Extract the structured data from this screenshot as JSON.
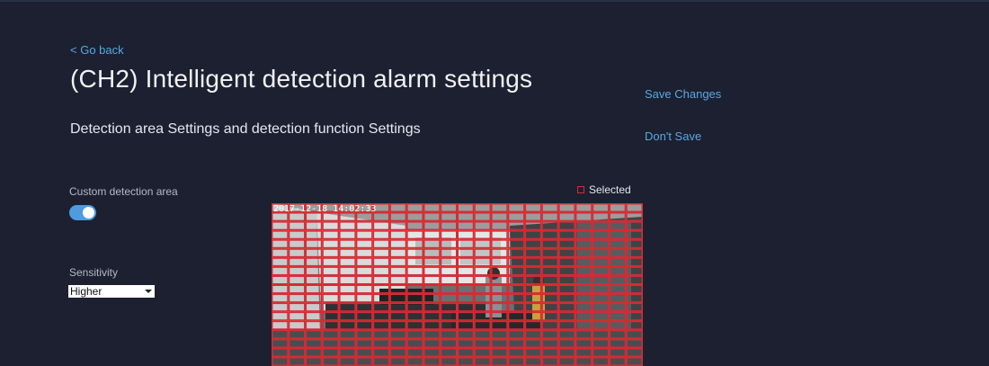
{
  "nav": {
    "back_label": "< Go back"
  },
  "header": {
    "title": "(CH2)  Intelligent detection alarm settings",
    "section_title": "Detection area Settings and detection function Settings"
  },
  "actions": {
    "save": "Save Changes",
    "dont_save": "Don't Save"
  },
  "settings": {
    "custom_area_label": "Custom detection area",
    "custom_area_enabled": true,
    "sensitivity_label": "Sensitivity",
    "sensitivity_value": "Higher"
  },
  "detection_grid": {
    "legend_label": "Selected",
    "osd_text": "2017-12-18 14:02:33",
    "columns": 22,
    "rows": 18,
    "all_selected": true,
    "selected_color": "#d62b33"
  },
  "colors": {
    "background": "#1c2030",
    "accent": "#58a8e0",
    "toggle_on": "#4e9ce0"
  }
}
